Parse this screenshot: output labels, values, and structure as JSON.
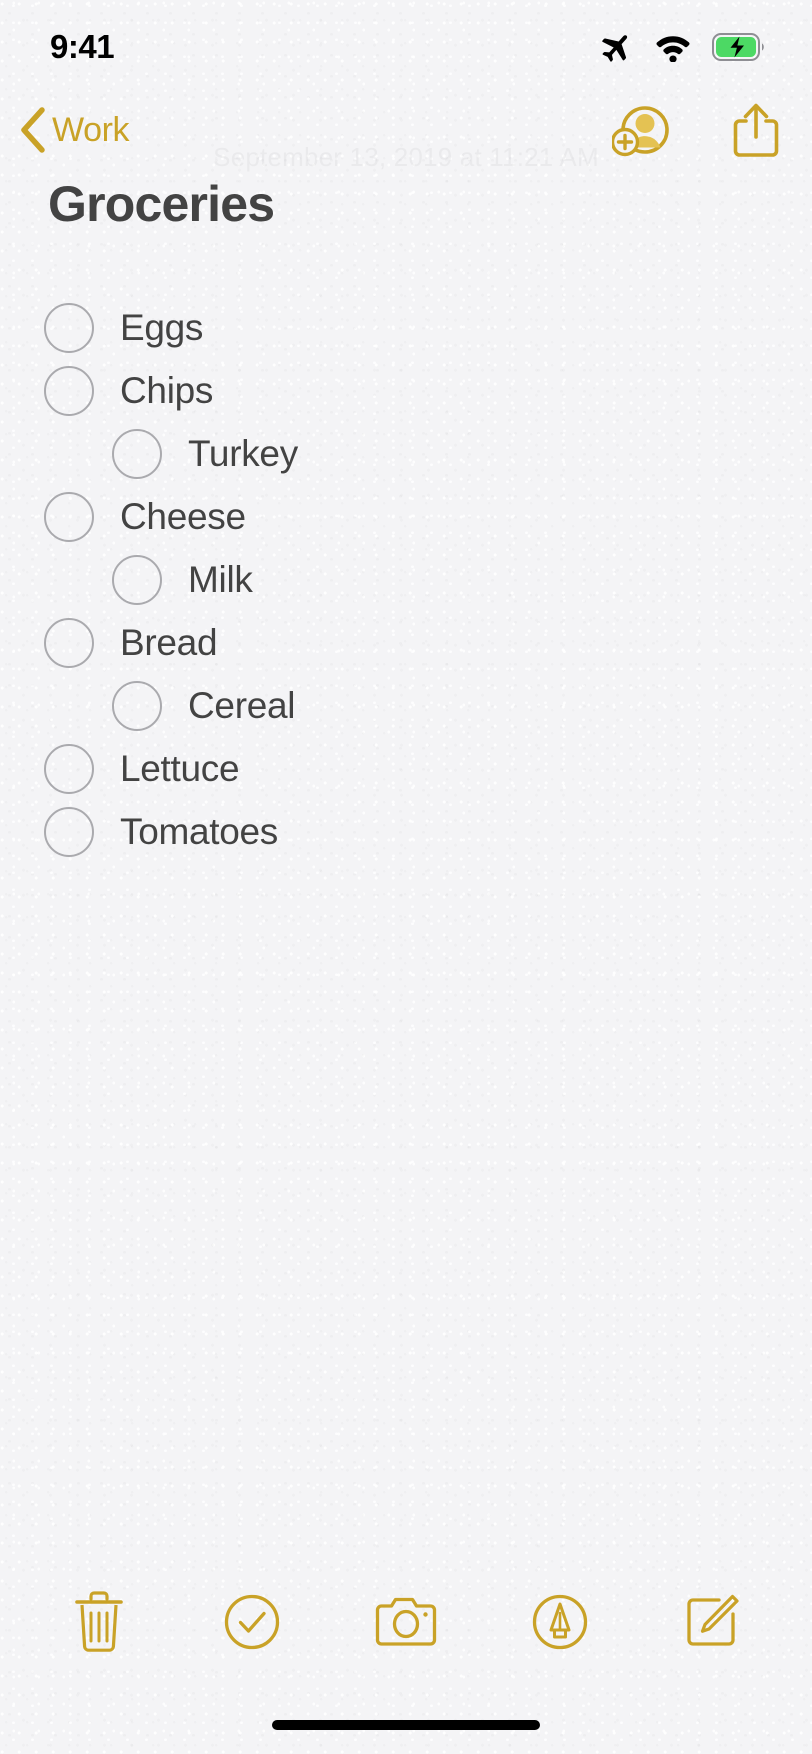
{
  "status_bar": {
    "time": "9:41",
    "icons": [
      "airplane-mode-icon",
      "wifi-icon",
      "battery-charging-icon"
    ],
    "battery_color": "#4cd964",
    "icon_color": "#000000"
  },
  "nav_bar": {
    "back_label": "Work",
    "back_icon": "chevron-left-icon",
    "accent_color": "#c9a227",
    "actions": [
      {
        "name": "add-person-icon",
        "label": "Add People"
      },
      {
        "name": "share-icon",
        "label": "Share"
      }
    ]
  },
  "note": {
    "ghost_date": "September 13, 2019 at 11:21 AM",
    "title": "Groceries",
    "title_color": "#434343",
    "checklist": [
      {
        "label": "Eggs",
        "checked": false,
        "indent": 0
      },
      {
        "label": "Chips",
        "checked": false,
        "indent": 0
      },
      {
        "label": "Turkey",
        "checked": false,
        "indent": 1
      },
      {
        "label": "Cheese",
        "checked": false,
        "indent": 0
      },
      {
        "label": "Milk",
        "checked": false,
        "indent": 1
      },
      {
        "label": "Bread",
        "checked": false,
        "indent": 0
      },
      {
        "label": "Cereal",
        "checked": false,
        "indent": 1
      },
      {
        "label": "Lettuce",
        "checked": false,
        "indent": 0
      },
      {
        "label": "Tomatoes",
        "checked": false,
        "indent": 0
      }
    ]
  },
  "toolbar": {
    "accent_color": "#c9a227",
    "items": [
      {
        "name": "trash-icon",
        "label": "Delete"
      },
      {
        "name": "checklist-icon",
        "label": "Checklist"
      },
      {
        "name": "camera-icon",
        "label": "Camera"
      },
      {
        "name": "markup-pen-icon",
        "label": "Markup"
      },
      {
        "name": "compose-icon",
        "label": "Compose"
      }
    ]
  },
  "home_indicator": {
    "name": "home-indicator",
    "color": "#000000"
  }
}
